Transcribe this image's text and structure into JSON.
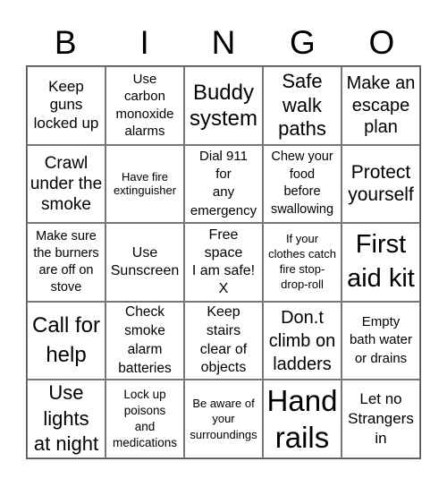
{
  "header": [
    "B",
    "I",
    "N",
    "G",
    "O"
  ],
  "cells": [
    "Keep\nguns\nlocked up",
    "Use\ncarbon\nmonoxide\nalarms",
    "Buddy\nsystem",
    "Safe\nwalk\npaths",
    "Make an\nescape\nplan",
    "Crawl\nunder the\nsmoke",
    "Have fire\nextinguisher",
    "Dial 911\nfor\nany\nemergency",
    "Chew your\nfood\nbefore\nswallowing",
    "Protect\nyourself",
    "Make sure\nthe burners\nare off on\nstove",
    "Use\nSunscreen",
    "Free\nspace\nI am safe!\nX",
    "If your\nclothes catch\nfire stop-\ndrop-roll",
    "First\naid kit",
    "Call for\nhelp",
    "Check\nsmoke\nalarm\nbatteries",
    "Keep\nstairs\nclear of\nobjects",
    "Don.t\nclimb on\nladders",
    "Empty\nbath water\nor drains",
    "Use\nlights\nat night",
    "Lock up\npoisons\nand\nmedications",
    "Be aware of\nyour\nsurroundings",
    "Hand\nrails",
    "Let no\nStrangers\nin"
  ]
}
